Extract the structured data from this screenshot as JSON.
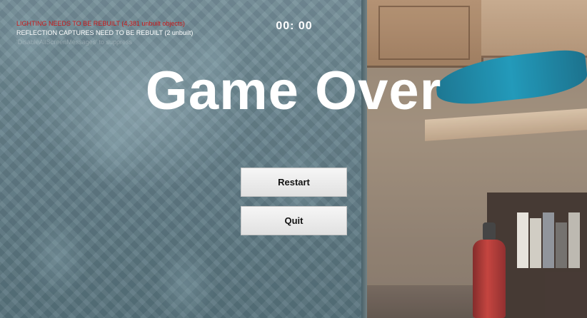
{
  "debug": {
    "lighting_warning": "LIGHTING NEEDS TO BE REBUILT (4,381 unbuilt objects)",
    "reflection_warning": "REFLECTION CAPTURES NEED TO BE REBUILT (2 unbuilt)",
    "suppress_hint": "'DisableAllScreenMessages' to suppress",
    "colors": {
      "warning": "#c81818",
      "info": "#ffffff"
    }
  },
  "hud": {
    "timer": "00: 00"
  },
  "game_over": {
    "title": "Game Over",
    "restart_label": "Restart",
    "quit_label": "Quit"
  }
}
